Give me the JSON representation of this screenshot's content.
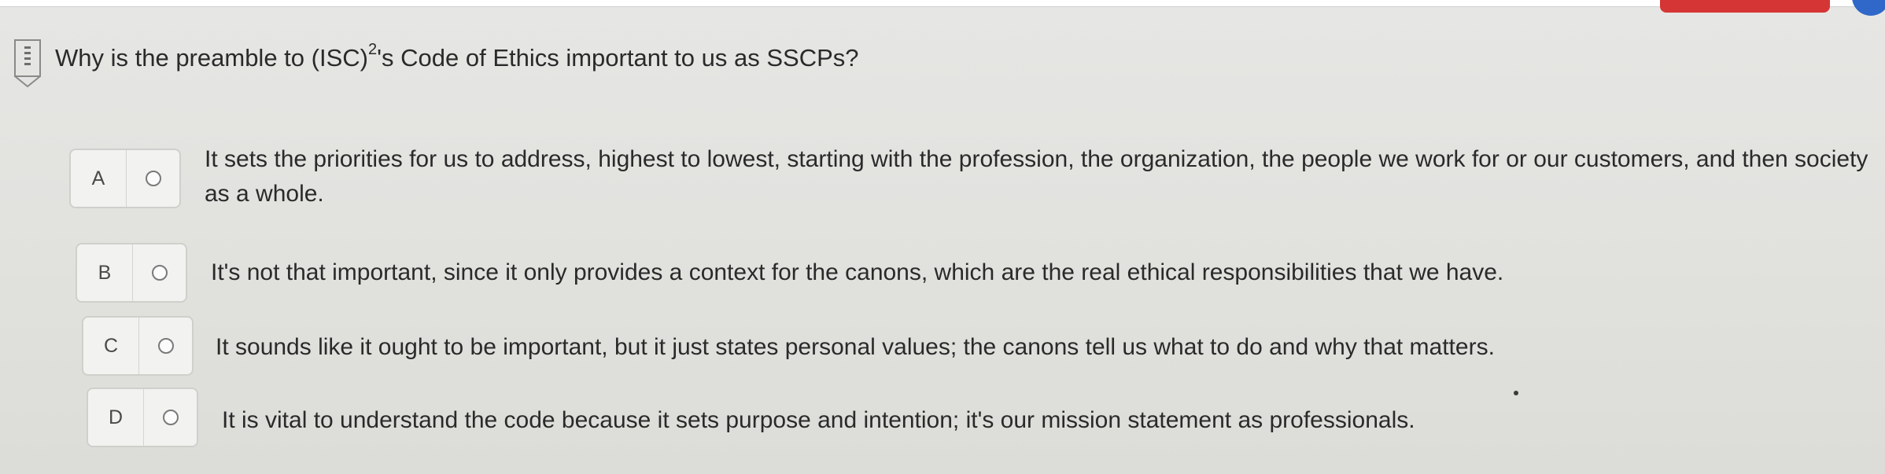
{
  "question": {
    "text_before": "Why is the preamble to (ISC)",
    "superscript": "2",
    "text_after": "'s Code of Ethics important to us as SSCPs?"
  },
  "options": [
    {
      "letter": "A",
      "text": "It sets the priorities for us to address, highest to lowest, starting with the profession, the organization, the people we work for or our customers, and then society as a whole."
    },
    {
      "letter": "B",
      "text": "It's not that important, since it only provides a context for the canons, which are the real ethical responsibilities that we have."
    },
    {
      "letter": "C",
      "text": "It sounds like it ought to be important, but it just states personal values; the canons tell us what to do and why that matters."
    },
    {
      "letter": "D",
      "text": "It is vital to understand the code because it sets purpose and intention; it's our mission statement as professionals."
    }
  ],
  "icons": {
    "bookmark": "bookmark-flag-icon",
    "radio": "radio-unselected-icon"
  },
  "colors": {
    "accent_red": "#d63535",
    "accent_blue": "#2f68c8"
  }
}
